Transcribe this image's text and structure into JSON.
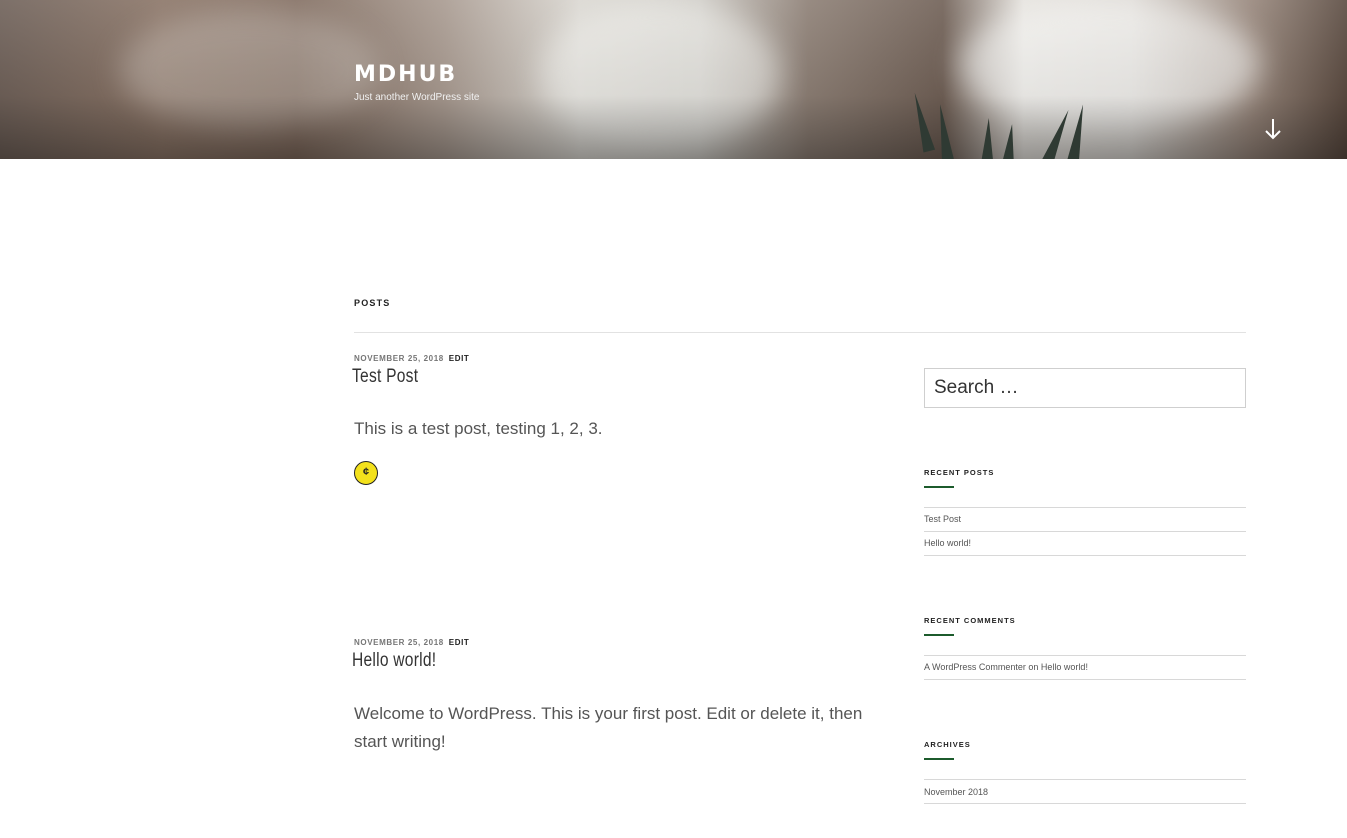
{
  "header": {
    "site_title": "MDHUB",
    "site_description": "Just another WordPress site",
    "scroll_icon": "arrow-down-icon"
  },
  "main": {
    "section_heading": "POSTS",
    "posts": [
      {
        "date": "NOVEMBER 25, 2018",
        "edit_label": "EDIT",
        "title": "Test Post",
        "body": "This is a test post, testing 1, 2, 3.",
        "emoji_icon": "cent-coin-icon",
        "emoji_glyph": "¢"
      },
      {
        "date": "NOVEMBER 25, 2018",
        "edit_label": "EDIT",
        "title": "Hello world!",
        "body": "Welcome to WordPress. This is your first post. Edit or delete it, then start writing!"
      }
    ]
  },
  "sidebar": {
    "search_placeholder": "Search …",
    "recent_posts": {
      "title": "RECENT POSTS",
      "items": [
        "Test Post",
        "Hello world!"
      ]
    },
    "recent_comments": {
      "title": "RECENT COMMENTS",
      "author": "A WordPress Commenter",
      "connector": "on",
      "post": "Hello world!"
    },
    "archives": {
      "title": "ARCHIVES",
      "items": [
        "November 2018"
      ]
    }
  },
  "colors": {
    "accent": "#1c5b2c",
    "coin": "#f3e11c"
  }
}
